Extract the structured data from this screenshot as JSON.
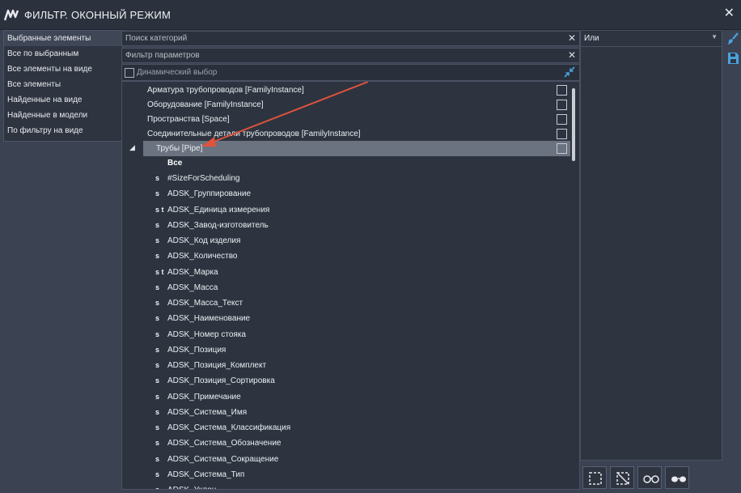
{
  "window": {
    "title": "ФИЛЬТР. ОКОННЫЙ РЕЖИМ",
    "logo_icon": "app-logo-icon",
    "close_icon": "close-icon",
    "close_glyph": "✕"
  },
  "left_menu": {
    "items": [
      {
        "label": "Выбранные элементы",
        "active": true
      },
      {
        "label": "Все по выбранным",
        "active": false
      },
      {
        "label": "Все элементы на виде",
        "active": false
      },
      {
        "label": "Все элементы",
        "active": false
      },
      {
        "label": "Найденные на виде",
        "active": false
      },
      {
        "label": "Найденные в модели",
        "active": false
      },
      {
        "label": "По фильтру на виде",
        "active": false
      }
    ]
  },
  "search": {
    "category_placeholder": "Поиск категорий",
    "param_placeholder": "Фильтр параметров",
    "clear_glyph": "✕"
  },
  "dynamic": {
    "label": "Динамический выбор",
    "checked": false
  },
  "categories": [
    {
      "label": "Арматура трубопроводов [FamilyInstance]",
      "checked": false
    },
    {
      "label": "Оборудование [FamilyInstance]",
      "checked": false
    },
    {
      "label": "Пространства [Space]",
      "checked": false
    },
    {
      "label": "Соединительные детали трубопроводов [FamilyInstance]",
      "checked": false
    }
  ],
  "selected_category": {
    "label": "Трубы [Pipe]",
    "expand_glyph": "◢",
    "checked": false
  },
  "params_header": "Все",
  "parameters": [
    {
      "flags": "s",
      "label": "#SizeForScheduling"
    },
    {
      "flags": "s",
      "label": "ADSK_Группирование"
    },
    {
      "flags": "s t",
      "label": "ADSK_Единица измерения"
    },
    {
      "flags": "s",
      "label": "ADSK_Завод-изготовитель"
    },
    {
      "flags": "s",
      "label": "ADSK_Код изделия"
    },
    {
      "flags": "s",
      "label": "ADSK_Количество"
    },
    {
      "flags": "s t",
      "label": "ADSK_Марка"
    },
    {
      "flags": "s",
      "label": "ADSK_Масса"
    },
    {
      "flags": "s",
      "label": "ADSK_Масса_Текст"
    },
    {
      "flags": "s",
      "label": "ADSK_Наименование"
    },
    {
      "flags": "s",
      "label": "ADSK_Номер стояка"
    },
    {
      "flags": "s",
      "label": "ADSK_Позиция"
    },
    {
      "flags": "s",
      "label": "ADSK_Позиция_Комплект"
    },
    {
      "flags": "s",
      "label": "ADSK_Позиция_Сортировка"
    },
    {
      "flags": "s",
      "label": "ADSK_Примечание"
    },
    {
      "flags": "s",
      "label": "ADSK_Система_Имя"
    },
    {
      "flags": "s",
      "label": "ADSK_Система_Классификация"
    },
    {
      "flags": "s",
      "label": "ADSK_Система_Обозначение"
    },
    {
      "flags": "s",
      "label": "ADSK_Система_Сокращение"
    },
    {
      "flags": "s",
      "label": "ADSK_Система_Тип"
    },
    {
      "flags": "s",
      "label": "ADSK_Уклон"
    }
  ],
  "logic": {
    "value": "Или",
    "arrow_glyph": "▼"
  },
  "tools": [
    "brush-icon",
    "save-icon"
  ],
  "bottom_buttons": [
    "select-box-icon",
    "deselect-box-icon",
    "glasses-icon",
    "sunglasses-icon"
  ],
  "colors": {
    "background": "#3b4252",
    "selected_row": "#6b7280",
    "arrow": "#e0533c",
    "accent": "#4aa3df"
  }
}
